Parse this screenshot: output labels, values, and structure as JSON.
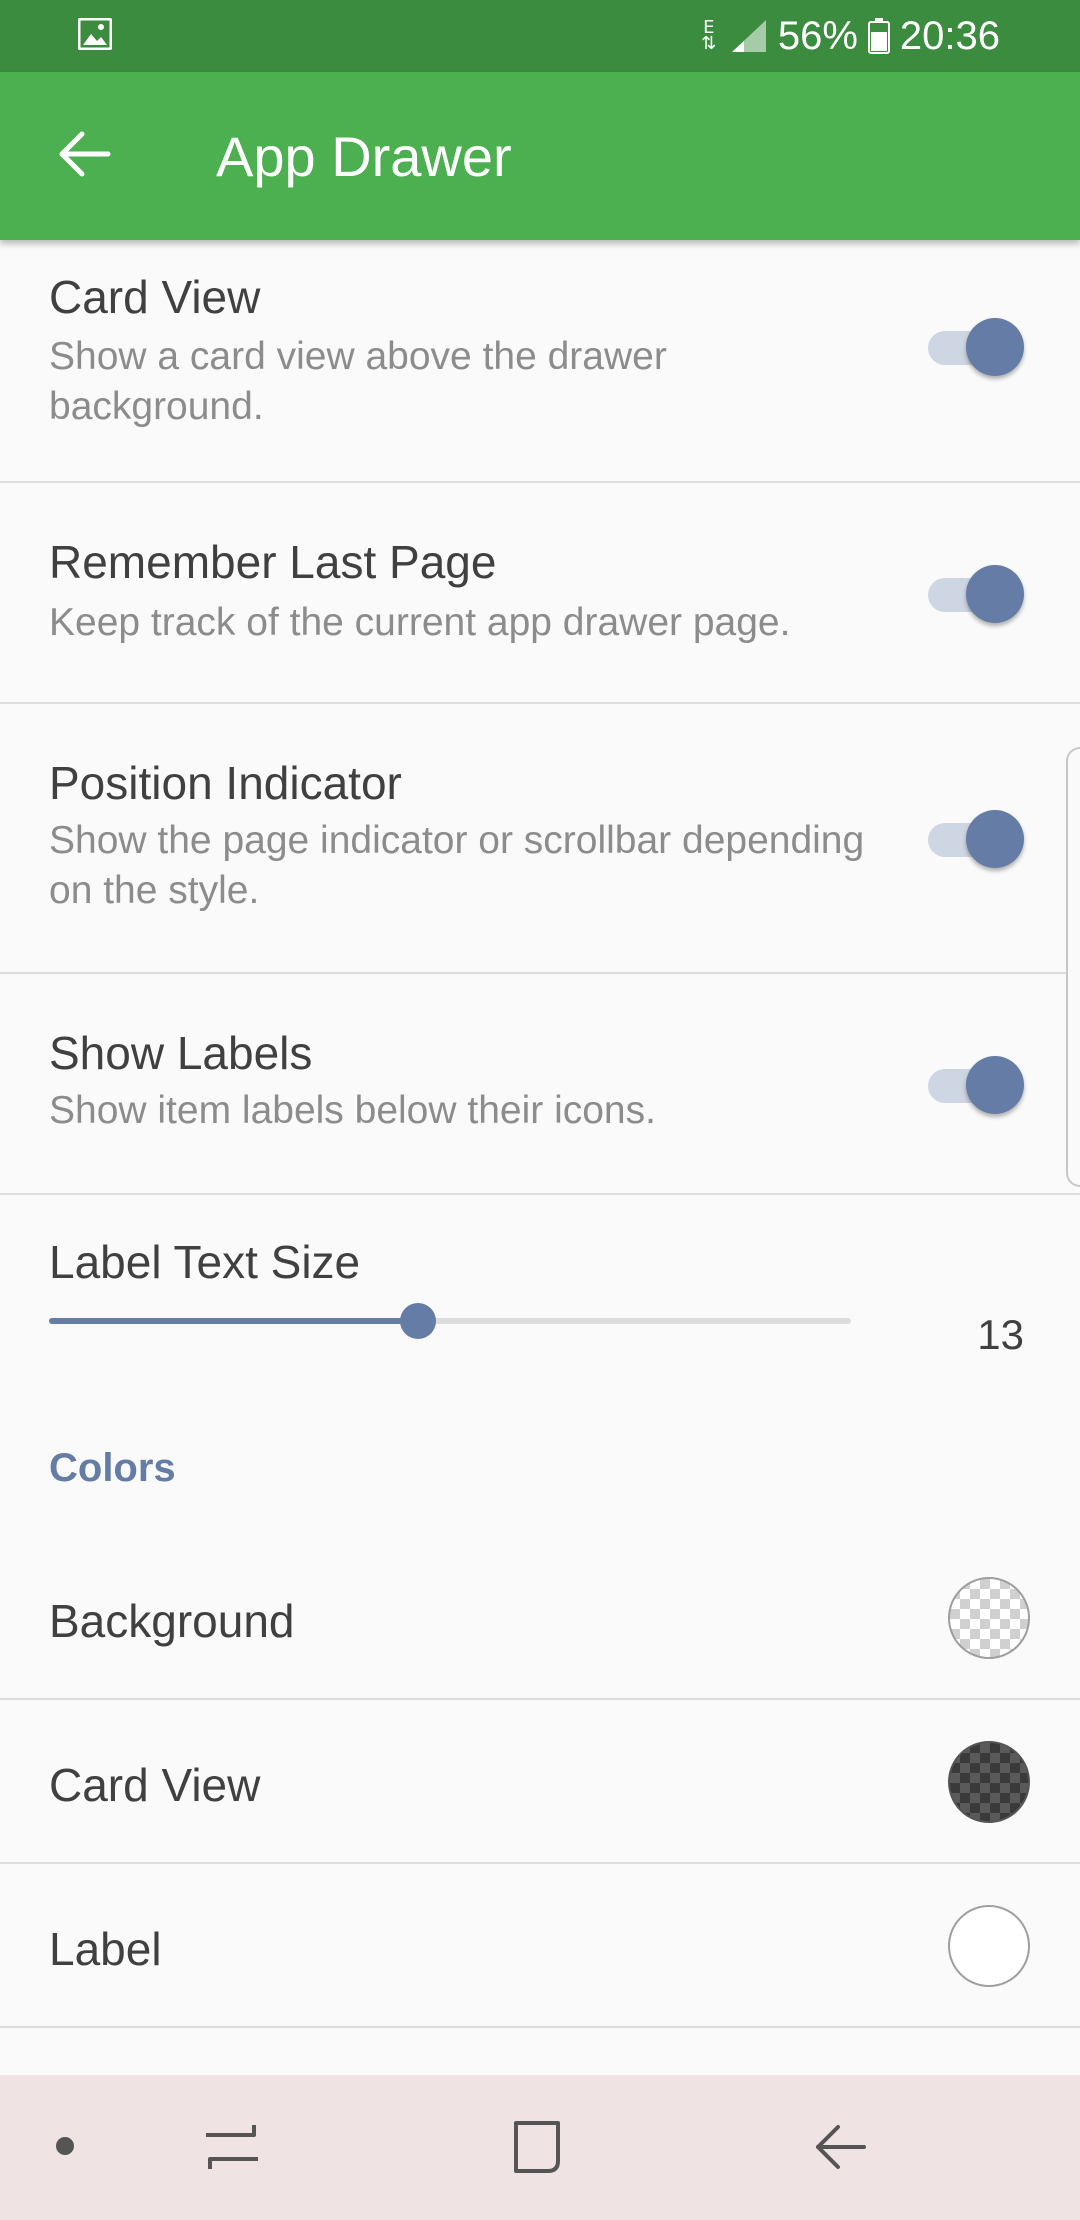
{
  "status_bar": {
    "left_icons": [
      "gallery-icon"
    ],
    "data_indicator": "E",
    "battery_percent": "56%",
    "time": "20:36"
  },
  "app_bar": {
    "title": "App Drawer",
    "back_icon": "arrow-back-icon",
    "background_color": "#4caf50"
  },
  "preferences": [
    {
      "title": "Card View",
      "summary": "Show a card view above the drawer background.",
      "enabled": true
    },
    {
      "title": "Remember Last Page",
      "summary": "Keep track of the current app drawer page.",
      "enabled": true
    },
    {
      "title": "Position Indicator",
      "summary": "Show the page indicator or scrollbar depending on the style.",
      "enabled": true
    },
    {
      "title": "Show Labels",
      "summary": "Show item labels below their icons.",
      "enabled": true
    }
  ],
  "label_text_size": {
    "title": "Label Text Size",
    "value": "13",
    "fill_fraction": 0.46
  },
  "colors_section": {
    "header": "Colors",
    "items": [
      {
        "title": "Background",
        "swatch": "transparent-light"
      },
      {
        "title": "Card View",
        "swatch": "transparent-dark"
      },
      {
        "title": "Label",
        "swatch": "#ffffff"
      }
    ]
  },
  "accent_color": "#647ca6",
  "nav_bar": {
    "icons": [
      "dot-icon",
      "recents-icon",
      "home-icon",
      "back-icon"
    ],
    "background_color": "#efe3e3"
  }
}
